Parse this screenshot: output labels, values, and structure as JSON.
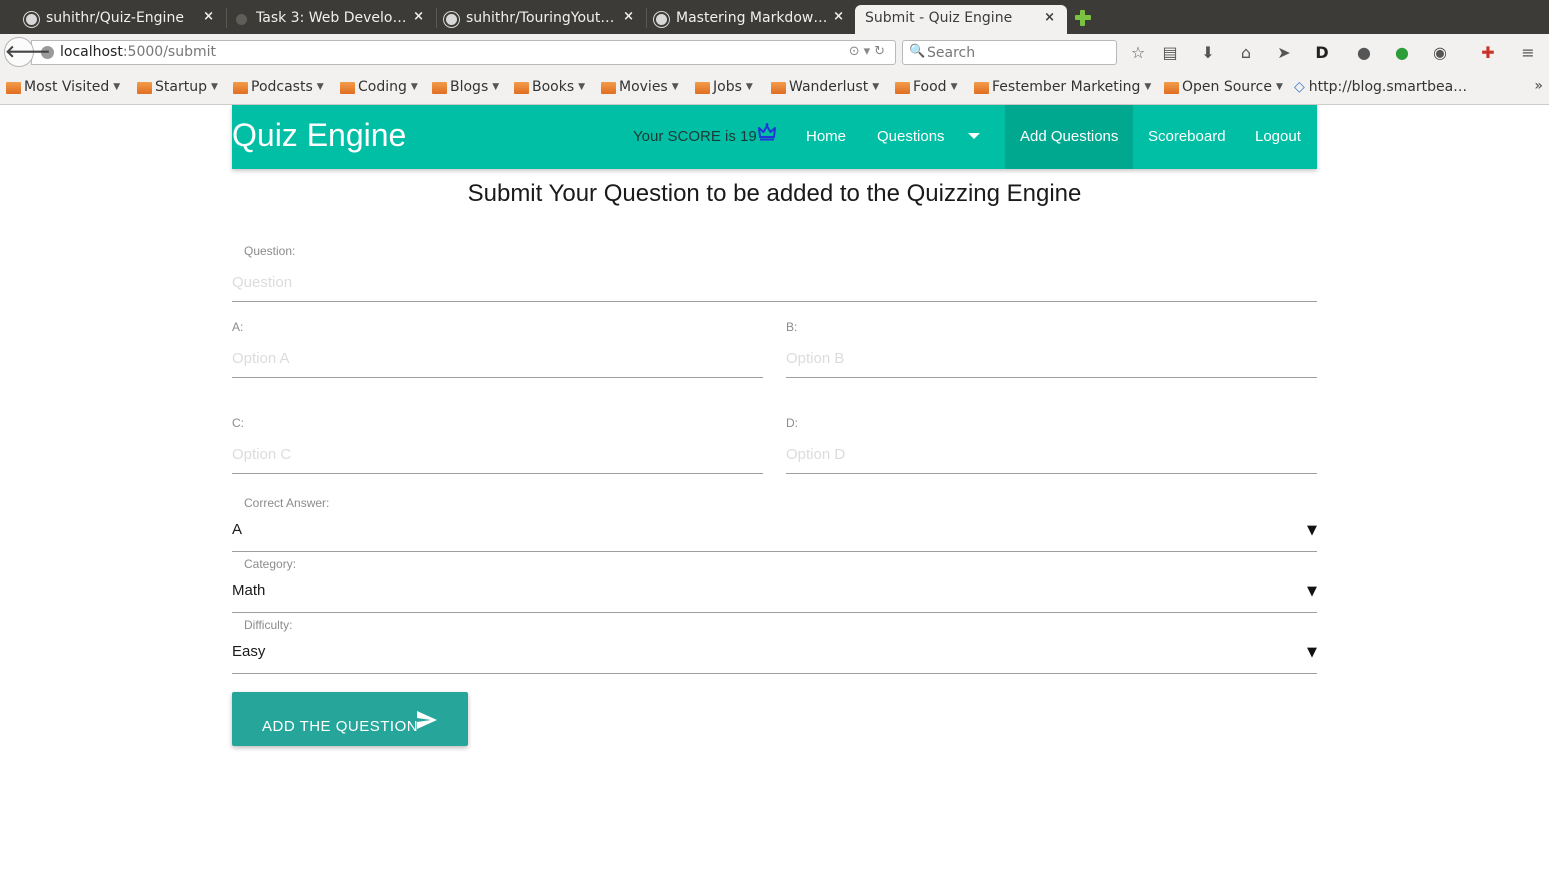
{
  "browser": {
    "tabs": [
      {
        "label": "suhithr/Quiz-Engine",
        "icon": "github-icon"
      },
      {
        "label": "Task 3: Web Develo…",
        "icon": "globe-icon"
      },
      {
        "label": "suhithr/TouringYout…",
        "icon": "github-icon"
      },
      {
        "label": "Mastering Markdow…",
        "icon": "github-icon"
      },
      {
        "label": "Submit - Quiz Engine",
        "icon": "none",
        "active": true
      }
    ],
    "close_glyph": "×",
    "url_host": "localhost",
    "url_path": ":5000/submit",
    "search_placeholder": "Search",
    "bookmarks": [
      {
        "label": "Most Visited",
        "type": "folder"
      },
      {
        "label": "Startup",
        "type": "folder"
      },
      {
        "label": "Podcasts",
        "type": "folder"
      },
      {
        "label": "Coding",
        "type": "folder"
      },
      {
        "label": "Blogs",
        "type": "folder"
      },
      {
        "label": "Books",
        "type": "folder"
      },
      {
        "label": "Movies",
        "type": "folder"
      },
      {
        "label": "Jobs",
        "type": "folder"
      },
      {
        "label": "Wanderlust",
        "type": "folder"
      },
      {
        "label": "Food",
        "type": "folder"
      },
      {
        "label": "Festember Marketing",
        "type": "folder"
      },
      {
        "label": "Open Source",
        "type": "folder"
      },
      {
        "label": "http://blog.smartbea…",
        "type": "link"
      }
    ]
  },
  "app": {
    "brand": "Quiz Engine",
    "score_text": "Your SCORE is 19",
    "nav": {
      "home": "Home",
      "questions": "Questions",
      "add_questions": "Add Questions",
      "scoreboard": "Scoreboard",
      "logout": "Logout"
    },
    "accent_color": "#00bfa5",
    "button_color": "#26a69a"
  },
  "form": {
    "heading": "Submit Your Question to be added to the Quizzing Engine",
    "question": {
      "label": "Question:",
      "placeholder": "Question"
    },
    "option_a": {
      "label": "A:",
      "placeholder": "Option A"
    },
    "option_b": {
      "label": "B:",
      "placeholder": "Option B"
    },
    "option_c": {
      "label": "C:",
      "placeholder": "Option C"
    },
    "option_d": {
      "label": "D:",
      "placeholder": "Option D"
    },
    "correct_answer": {
      "label": "Correct Answer:",
      "value": "A"
    },
    "category": {
      "label": "Category:",
      "value": "Math"
    },
    "difficulty": {
      "label": "Difficulty:",
      "value": "Easy"
    },
    "submit_label": "ADD THE QUESTION"
  }
}
